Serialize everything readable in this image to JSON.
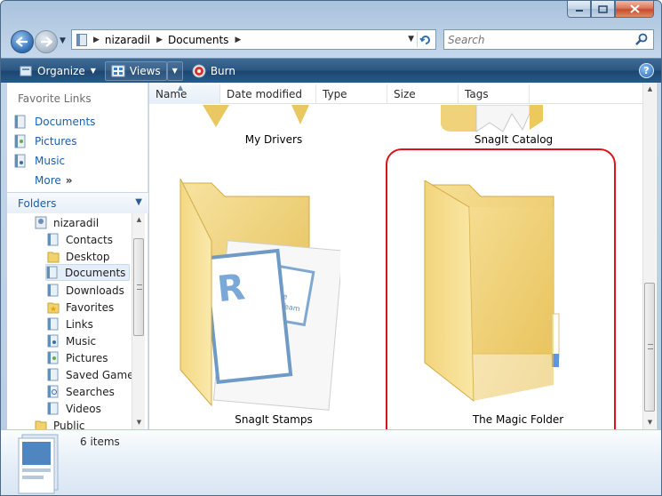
{
  "window": {
    "minimize_icon": "minimize-icon",
    "maximize_icon": "maximize-icon",
    "close_icon": "close-icon"
  },
  "address": {
    "breadcrumbs": [
      "nizaradil",
      "Documents"
    ],
    "search_placeholder": "Search"
  },
  "toolbar": {
    "organize": "Organize",
    "views": "Views",
    "burn": "Burn"
  },
  "nav": {
    "favorite_links_title": "Favorite Links",
    "favorites": [
      "Documents",
      "Pictures",
      "Music"
    ],
    "more": "More",
    "folders_title": "Folders",
    "tree": [
      "nizaradil",
      "Contacts",
      "Desktop",
      "Documents",
      "Downloads",
      "Favorites",
      "Links",
      "Music",
      "Pictures",
      "Saved Games",
      "Searches",
      "Videos",
      "Public"
    ],
    "selected": "Documents"
  },
  "columns": [
    "Name",
    "Date modified",
    "Type",
    "Size",
    "Tags"
  ],
  "items": [
    "My Drivers",
    "SnagIt Catalog",
    "SnagIt Stamps",
    "The Magic Folder"
  ],
  "stamp_text": [
    "R",
    "rtware",
    "view Team"
  ],
  "status": {
    "count": "6 items"
  },
  "colors": {
    "accent": "#1b5fa7",
    "command_bar": "#2b5681",
    "highlight_ring": "#e2101a",
    "folder": "#f3d57a"
  }
}
